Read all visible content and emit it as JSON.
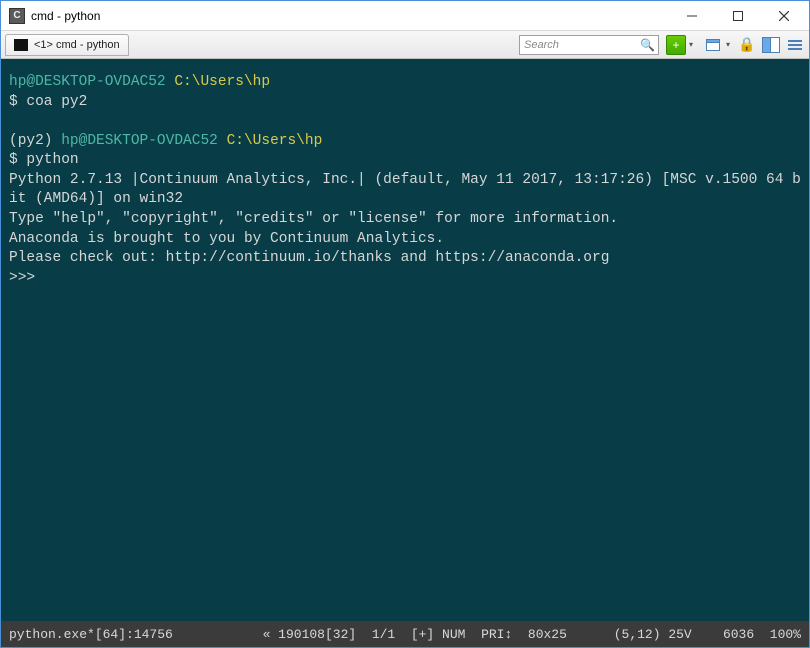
{
  "window": {
    "title": "cmd - python",
    "app_icon_letter": "C"
  },
  "tab": {
    "label": "<1> cmd - python"
  },
  "search": {
    "placeholder": "Search"
  },
  "terminal": {
    "line1_userhost": "hp@DESKTOP-OVDAC52",
    "line1_path": "C:\\Users\\hp",
    "line2": "$ coa py2",
    "line3_env": "(py2)",
    "line3_userhost": "hp@DESKTOP-OVDAC52",
    "line3_path": "C:\\Users\\hp",
    "line4": "$ python",
    "line5": "Python 2.7.13 |Continuum Analytics, Inc.| (default, May 11 2017, 13:17:26) [MSC v.1500 64 bit (AMD64)] on win32",
    "line6": "Type \"help\", \"copyright\", \"credits\" or \"license\" for more information.",
    "line7": "Anaconda is brought to you by Continuum Analytics.",
    "line8": "Please check out: http://continuum.io/thanks and https://anaconda.org",
    "line9": ">>>"
  },
  "status": {
    "left": "python.exe*[64]:14756",
    "s1": "« 190108[32]",
    "s2": "1/1",
    "s3": "[+]",
    "s4": "NUM",
    "s5": "PRI↕",
    "s6": "80x25",
    "s7": "(5,12) 25V",
    "s8": "6036",
    "s9": "100%"
  }
}
